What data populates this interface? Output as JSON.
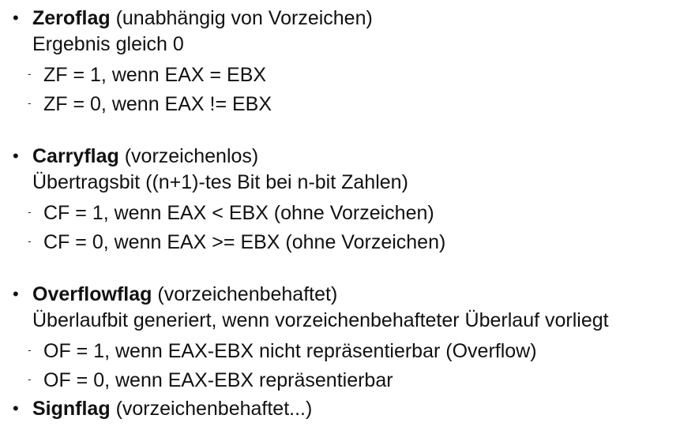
{
  "flags": [
    {
      "name": "Zeroflag",
      "qualifier": "(unabhängig von Vorzeichen)",
      "description": "Ergebnis gleich 0",
      "cases": [
        "ZF = 1, wenn EAX = EBX",
        "ZF = 0, wenn EAX != EBX"
      ]
    },
    {
      "name": "Carryflag",
      "qualifier": "(vorzeichenlos)",
      "description": "Übertragsbit ((n+1)-tes Bit bei n-bit Zahlen)",
      "cases": [
        "CF = 1, wenn EAX < EBX (ohne Vorzeichen)",
        "CF = 0, wenn EAX >= EBX (ohne Vorzeichen)"
      ]
    },
    {
      "name": "Overflowflag",
      "qualifier": "(vorzeichenbehaftet)",
      "description": "Überlaufbit generiert, wenn vorzeichenbehafteter Überlauf vorliegt",
      "cases": [
        "OF = 1, wenn EAX-EBX nicht repräsentierbar (Overflow)",
        "OF = 0, wenn EAX-EBX repräsentierbar"
      ]
    },
    {
      "name": "Signflag",
      "qualifier": "(vorzeichenbehaftet...)"
    }
  ],
  "bullet_symbol": "•",
  "dash_symbol": "-"
}
